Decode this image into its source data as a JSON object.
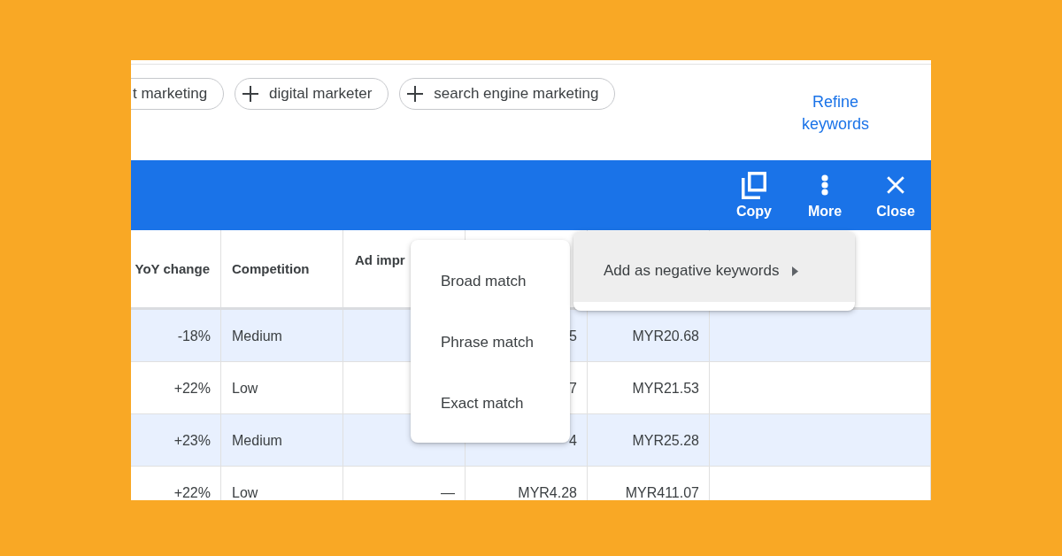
{
  "keyword_chips": [
    {
      "label": "t marketing",
      "kind": "partial"
    },
    {
      "label": "digital marketer",
      "kind": "add"
    },
    {
      "label": "search engine marketing",
      "kind": "add"
    }
  ],
  "refine_link": "Refine keywords",
  "action_bar": {
    "actions": [
      {
        "kind": "copy",
        "label": "Copy"
      },
      {
        "kind": "more",
        "label": "More"
      },
      {
        "kind": "close",
        "label": "Close"
      }
    ]
  },
  "table": {
    "columns": [
      "YoY change",
      "Competition",
      "Ad impr"
    ],
    "rows": [
      {
        "selected": true,
        "yoy_change": "-18%",
        "competition": "Medium",
        "column_4": "5",
        "column_5": "MYR20.68"
      },
      {
        "selected": false,
        "yoy_change": "+22%",
        "competition": "Low",
        "column_4": "7",
        "column_5": "MYR21.53"
      },
      {
        "selected": true,
        "yoy_change": "+23%",
        "competition": "Medium",
        "column_4": "4",
        "column_5": "MYR25.28"
      },
      {
        "selected": false,
        "yoy_change": "+22%",
        "competition": "Low",
        "ad_impr": "—",
        "column_4": "MYR4.28",
        "column_5": "MYR411.07"
      }
    ]
  },
  "context_menu": {
    "items": [
      {
        "label": "Add as negative keywords",
        "highlighted": true,
        "submenu": [
          {
            "label": "Broad match"
          },
          {
            "label": "Phrase match"
          },
          {
            "label": "Exact match"
          }
        ]
      }
    ]
  }
}
